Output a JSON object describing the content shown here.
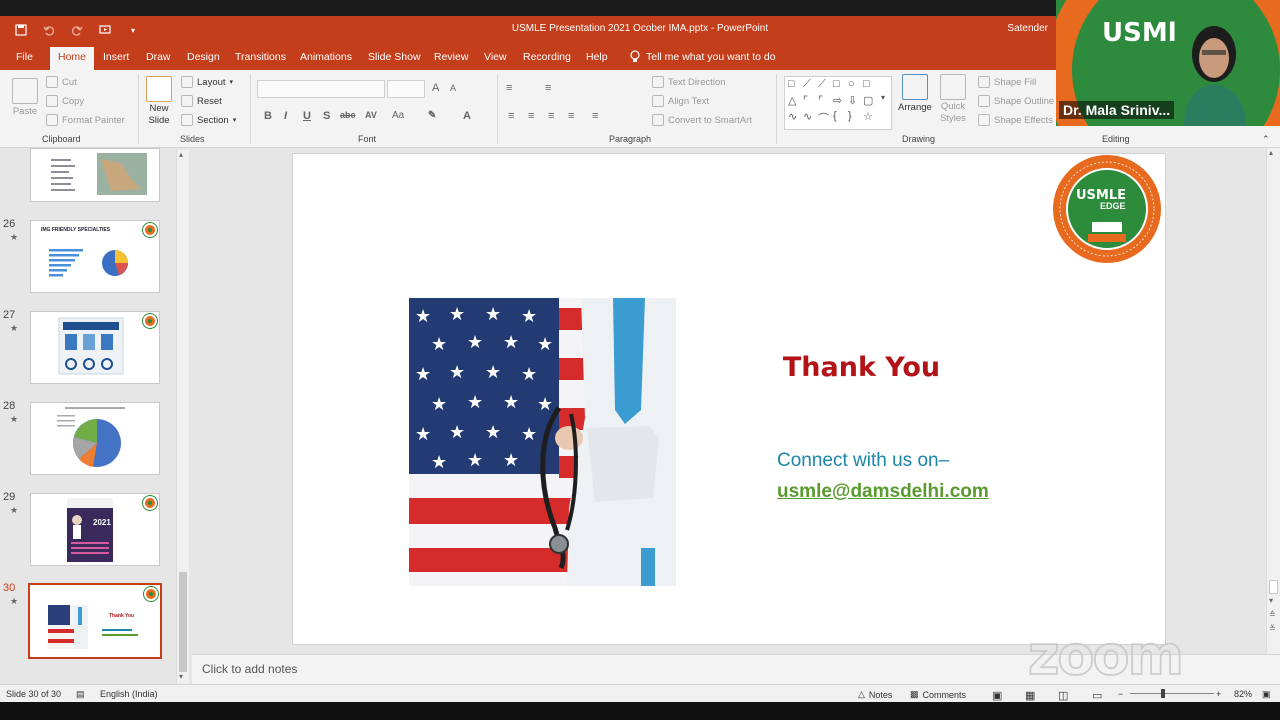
{
  "window": {
    "document_title": "USMLE Presentation 2021 Ocober IMA.pptx  -  PowerPoint",
    "user_name": "Satender"
  },
  "tabs": [
    {
      "label": "File",
      "active": false
    },
    {
      "label": "Home",
      "active": true
    },
    {
      "label": "Insert",
      "active": false
    },
    {
      "label": "Draw",
      "active": false
    },
    {
      "label": "Design",
      "active": false
    },
    {
      "label": "Transitions",
      "active": false
    },
    {
      "label": "Animations",
      "active": false
    },
    {
      "label": "Slide Show",
      "active": false
    },
    {
      "label": "Review",
      "active": false
    },
    {
      "label": "View",
      "active": false
    },
    {
      "label": "Recording",
      "active": false
    },
    {
      "label": "Help",
      "active": false
    }
  ],
  "tell_me": "Tell me what you want to do",
  "ribbon": {
    "clipboard": {
      "paste": "Paste",
      "cut": "Cut",
      "copy": "Copy",
      "format_painter": "Format Painter",
      "label": "Clipboard"
    },
    "slides": {
      "new_slide_1": "New",
      "new_slide_2": "Slide",
      "layout": "Layout",
      "reset": "Reset",
      "section": "Section",
      "label": "Slides"
    },
    "font": {
      "label": "Font"
    },
    "paragraph": {
      "text_direction": "Text Direction",
      "align_text": "Align Text",
      "convert_smartart": "Convert to SmartArt",
      "label": "Paragraph"
    },
    "drawing": {
      "arrange": "Arrange",
      "quick_styles_1": "Quick",
      "quick_styles_2": "Styles",
      "shape_fill": "Shape Fill",
      "shape_outline": "Shape Outline",
      "shape_effects": "Shape Effects",
      "label": "Drawing"
    },
    "editing": {
      "label": "Editing"
    }
  },
  "thumbnails": [
    {
      "number": "",
      "title": ""
    },
    {
      "number": "26",
      "title": "IMG FRIENDLY SPECIALTIES"
    },
    {
      "number": "27",
      "title": ""
    },
    {
      "number": "28",
      "title": ""
    },
    {
      "number": "29",
      "title": "2021"
    },
    {
      "number": "30",
      "title": "Thank You",
      "selected": true
    }
  ],
  "slide": {
    "heading": "Thank You",
    "connect_text": "Connect with us on–",
    "email": "usmle@damsdelhi.com",
    "logo_text": "USMLE",
    "logo_sub": "EDGE"
  },
  "notes_placeholder": "Click to add notes",
  "status": {
    "slide_info": "Slide 30 of 30",
    "language": "English (India)",
    "notes": "Notes",
    "comments": "Comments",
    "zoom": "82%"
  },
  "video": {
    "participant_name": "Dr. Mala Sriniv...",
    "brand_text": "USMl"
  },
  "watermark": "zoom",
  "colors": {
    "accent": "#c43e1c",
    "thank_you": "#b31217",
    "connect": "#1a86a8",
    "email": "#5a9a2e"
  }
}
